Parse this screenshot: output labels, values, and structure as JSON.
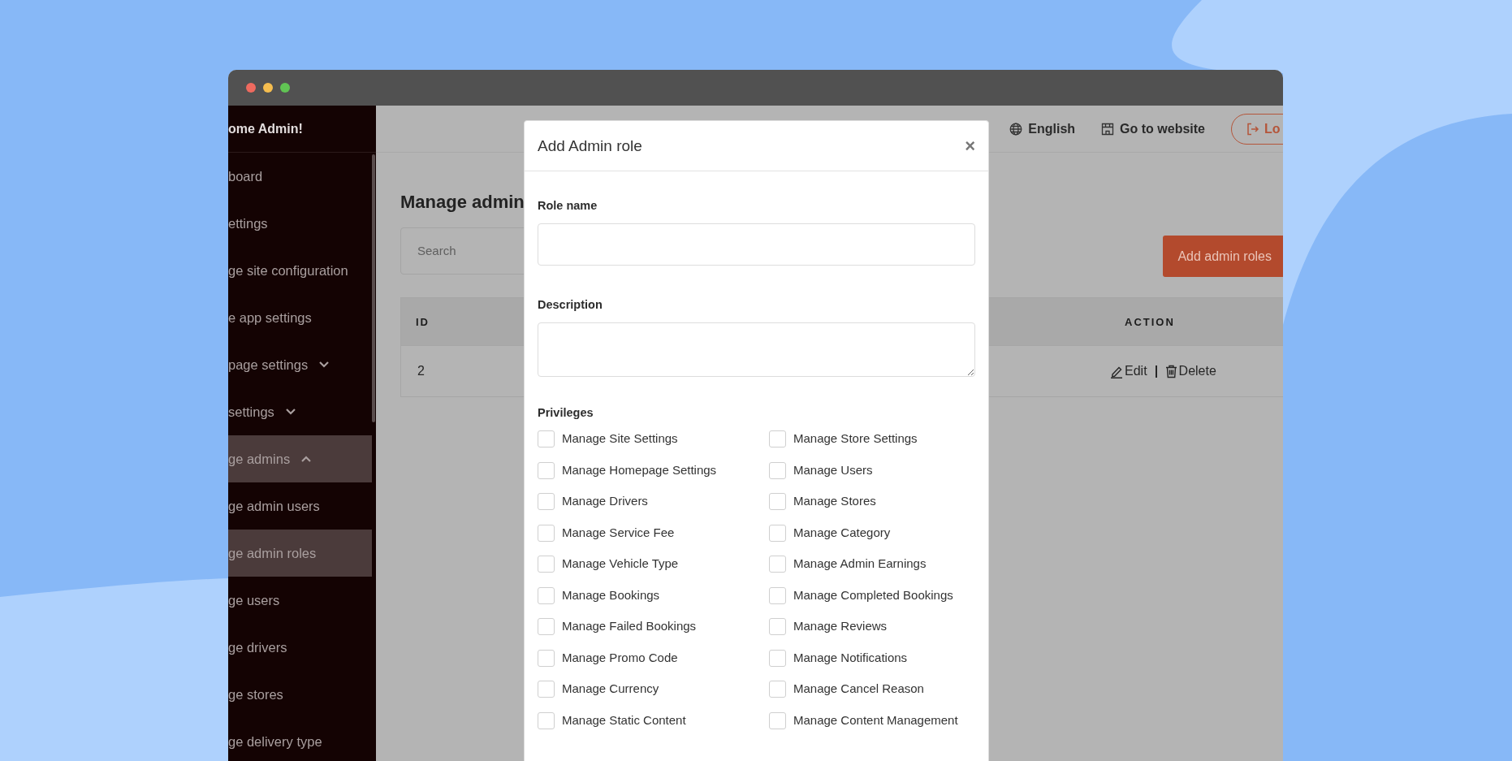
{
  "sidebar": {
    "header": "ome Admin!",
    "items": [
      {
        "label": "board",
        "kind": "link",
        "selected": false
      },
      {
        "label": "ettings",
        "kind": "link",
        "selected": false
      },
      {
        "label": "ge site configuration",
        "kind": "link",
        "selected": false
      },
      {
        "label": "e app settings",
        "kind": "link",
        "selected": false
      },
      {
        "label": "page settings",
        "kind": "group",
        "selected": false,
        "expanded": false
      },
      {
        "label": "settings",
        "kind": "group",
        "selected": false,
        "expanded": false
      },
      {
        "label": "ge admins",
        "kind": "group",
        "selected": true,
        "expanded": true
      },
      {
        "label": "ge admin users",
        "kind": "link",
        "selected": false
      },
      {
        "label": "ge admin roles",
        "kind": "link",
        "selected": true
      },
      {
        "label": "ge users",
        "kind": "link",
        "selected": false
      },
      {
        "label": "ge drivers",
        "kind": "link",
        "selected": false
      },
      {
        "label": "ge stores",
        "kind": "link",
        "selected": false
      },
      {
        "label": "ge delivery type",
        "kind": "link",
        "selected": false
      }
    ]
  },
  "topbar": {
    "language": "English",
    "website_link": "Go to website",
    "logout_button": "Lo"
  },
  "page": {
    "title": "Manage admin",
    "search": {
      "placeholder": "Search"
    },
    "add_button": "Add admin roles",
    "table": {
      "columns": [
        "ID",
        "ACTION"
      ],
      "rows": [
        {
          "id": "2",
          "actions": [
            {
              "kind": "edit",
              "label": "Edit"
            },
            {
              "kind": "delete",
              "label": "Delete"
            }
          ]
        }
      ]
    }
  },
  "modal": {
    "title": "Add Admin role",
    "close": "×",
    "fields": [
      {
        "label": "Role name",
        "kind": "input"
      },
      {
        "label": "Description",
        "kind": "textarea"
      }
    ],
    "privileges_label": "Privileges",
    "privileges": [
      {
        "label": "Manage Site Settings",
        "checked": false
      },
      {
        "label": "Manage Store Settings",
        "checked": false
      },
      {
        "label": "Manage Homepage Settings",
        "checked": false
      },
      {
        "label": "Manage Users",
        "checked": false
      },
      {
        "label": "Manage Drivers",
        "checked": false
      },
      {
        "label": "Manage Stores",
        "checked": false
      },
      {
        "label": "Manage Service Fee",
        "checked": false
      },
      {
        "label": "Manage Category",
        "checked": false
      },
      {
        "label": "Manage Vehicle Type",
        "checked": false
      },
      {
        "label": "Manage Admin Earnings",
        "checked": false
      },
      {
        "label": "Manage Bookings",
        "checked": false
      },
      {
        "label": "Manage Completed Bookings",
        "checked": false
      },
      {
        "label": "Manage Failed Bookings",
        "checked": false
      },
      {
        "label": "Manage Reviews",
        "checked": false
      },
      {
        "label": "Manage Promo Code",
        "checked": false
      },
      {
        "label": "Manage Notifications",
        "checked": false
      },
      {
        "label": "Manage Currency",
        "checked": false
      },
      {
        "label": "Manage Cancel Reason",
        "checked": false
      },
      {
        "label": "Manage Static Content",
        "checked": false
      },
      {
        "label": "Manage Content Management",
        "checked": false
      }
    ]
  }
}
